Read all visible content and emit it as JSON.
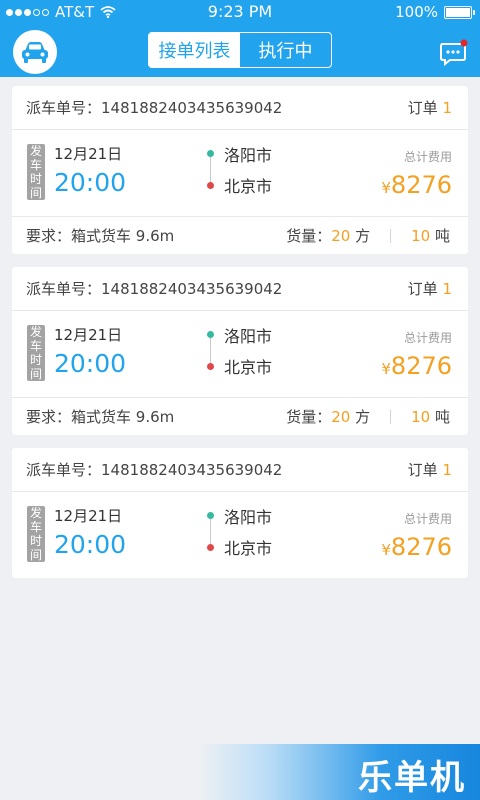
{
  "status_bar": {
    "carrier": "AT&T",
    "time": "9:23 PM",
    "battery": "100%"
  },
  "nav": {
    "tabs": [
      {
        "label": "接单列表",
        "active": true
      },
      {
        "label": "执行中",
        "active": false
      }
    ]
  },
  "labels": {
    "dispatch_prefix": "派车单号：",
    "order_prefix": "订单 ",
    "depart_tag": "发车时间",
    "total_fee": "总计费用",
    "currency": "¥",
    "requirement_prefix": "要求：",
    "volume_prefix": "货量：",
    "volume_unit": " 方",
    "weight_unit": " 吨"
  },
  "orders": [
    {
      "dispatch_no": "1481882403435639042",
      "order_count": "1",
      "date": "12月21日",
      "time": "20:00",
      "from": "洛阳市",
      "to": "北京市",
      "fee": "8276",
      "requirement": "箱式货车  9.6m",
      "volume": "20",
      "weight": "10"
    },
    {
      "dispatch_no": "1481882403435639042",
      "order_count": "1",
      "date": "12月21日",
      "time": "20:00",
      "from": "洛阳市",
      "to": "北京市",
      "fee": "8276",
      "requirement": "箱式货车  9.6m",
      "volume": "20",
      "weight": "10"
    },
    {
      "dispatch_no": "1481882403435639042",
      "order_count": "1",
      "date": "12月21日",
      "time": "20:00",
      "from": "洛阳市",
      "to": "北京市",
      "fee": "8276"
    }
  ],
  "watermark": "乐单机",
  "colors": {
    "primary": "#21a3ee",
    "accent": "#f4a021",
    "from_dot": "#35b9a0",
    "to_dot": "#e04848"
  }
}
